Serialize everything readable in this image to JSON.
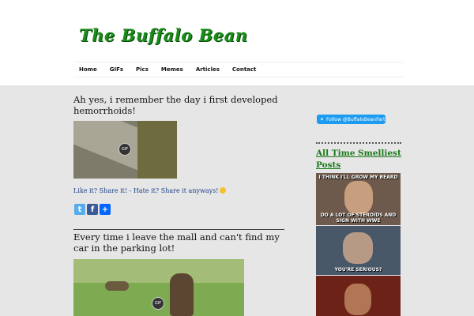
{
  "site": {
    "title": "The Buffalo Bean",
    "logo_icon": "buffalo-mascot"
  },
  "nav": {
    "items": [
      "Home",
      "GIFs",
      "Pics",
      "Memes",
      "Articles",
      "Contact"
    ]
  },
  "posts": [
    {
      "title": "Ah yes, i remember the day i first developed hemorrhoids!",
      "badge": "GIF",
      "share_text": "Like it? Share it! - Hate it? Share it anyways!"
    },
    {
      "title": "Every time i leave the mall and can't find my car in the parking lot!",
      "badge": "GIF"
    }
  ],
  "sidebar": {
    "follow_label": "Follow @BuffaloBeanFart",
    "heading": "All Time Smelliest Posts",
    "memes": [
      {
        "top": "I THINK I'LL GROW MY BEARD",
        "bottom": "DO A LOT OF STEROIDS AND SIGN WITH WWE"
      },
      {
        "top": "",
        "bottom": "YOU'RE SERIOUS?"
      },
      {
        "top": "",
        "bottom": ""
      }
    ]
  },
  "social_icons": [
    "twitter-icon",
    "facebook-icon",
    "share-plus-icon"
  ],
  "colors": {
    "brand_green": "#1a8d1a",
    "link_blue": "#1d3f8a",
    "twitter_blue": "#1d9bf0"
  }
}
